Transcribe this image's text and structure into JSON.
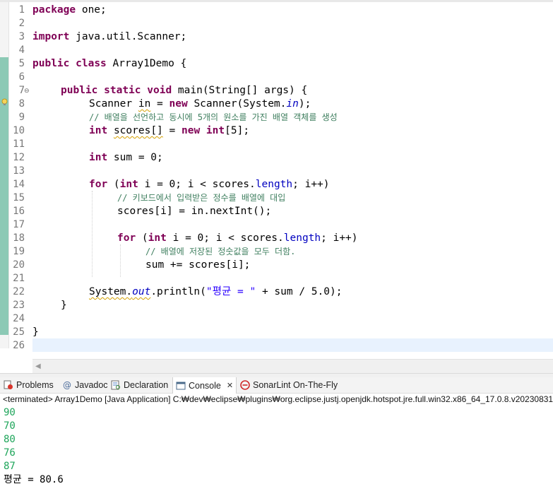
{
  "editor": {
    "line_numbers": [
      "1",
      "2",
      "3",
      "4",
      "5",
      "6",
      "7",
      "8",
      "9",
      "10",
      "11",
      "12",
      "13",
      "14",
      "15",
      "16",
      "17",
      "18",
      "19",
      "20",
      "21",
      "22",
      "23",
      "24",
      "25",
      "26"
    ],
    "lines": {
      "l1_kw": "package",
      "l1_rest": " one;",
      "l3_kw": "import",
      "l3_rest": " java.util.Scanner;",
      "l5_kw1": "public",
      "l5_kw2": "class",
      "l5_rest": " Array1Demo {",
      "l7_kw1": "public",
      "l7_kw2": "static",
      "l7_kw3": "void",
      "l7_rest": " main(String[] args) {",
      "l8_a": "Scanner ",
      "l8_var": "in",
      "l8_b": " = ",
      "l8_kw": "new",
      "l8_c": " Scanner(System.",
      "l8_fld": "in",
      "l8_d": ");",
      "l9_comment": "// 배열을 선언하고 동시에 5개의 원소를 가진 배열 객체를 생성",
      "l10_kw1": "int",
      "l10_var": "scores[]",
      "l10_b": " = ",
      "l10_kw2": "new",
      "l10_kw3": "int",
      "l10_c": "[5];",
      "l12_kw": "int",
      "l12_rest": " sum = 0;",
      "l14_kw1": "for",
      "l14_a": " (",
      "l14_kw2": "int",
      "l14_b": " i = 0; i < scores.",
      "l14_fld": "length",
      "l14_c": "; i++)",
      "l15_comment": "// 키보드에서 입력받은 정수를 배열에 대입",
      "l16_code": "scores[i] = in.nextInt();",
      "l18_kw1": "for",
      "l18_a": " (",
      "l18_kw2": "int",
      "l18_b": " i = 0; i < scores.",
      "l18_fld": "length",
      "l18_c": "; i++)",
      "l19_comment": "// 배열에 저장된 정숫값을 모두 더함.",
      "l20_code": "sum += scores[i];",
      "l22_a": "System.",
      "l22_fld": "out",
      "l22_b": ".println(",
      "l22_str": "\"평균 = \"",
      "l22_c": " + sum / 5.0);",
      "l23_code": "}",
      "l25_code": "}"
    }
  },
  "panel": {
    "tabs": [
      {
        "label": "Problems",
        "icon": "problems-icon"
      },
      {
        "label": "Javadoc",
        "icon": "javadoc-at-icon"
      },
      {
        "label": "Declaration",
        "icon": "declaration-icon"
      },
      {
        "label": "Console",
        "icon": "console-icon",
        "active": true
      },
      {
        "label": "SonarLint On-The-Fly",
        "icon": "sonarlint-icon"
      }
    ],
    "close_glyph": "✕",
    "status": "<terminated> Array1Demo [Java Application] C:₩dev₩eclipse₩plugins₩org.eclipse.justj.openjdk.hotspot.jre.full.win32.x86_64_17.0.8.v20230831",
    "console_input": [
      "90",
      "70",
      "80",
      "76",
      "87"
    ],
    "console_output": "평균 = 80.6"
  },
  "colors": {
    "keyword": "#7f0055",
    "comment": "#3f7f5f",
    "field": "#0000c0",
    "string": "#2a00ff",
    "console_input": "#1ea55a",
    "quickdiff": "#8cc9b5",
    "current_line": "#e8f2fe"
  }
}
